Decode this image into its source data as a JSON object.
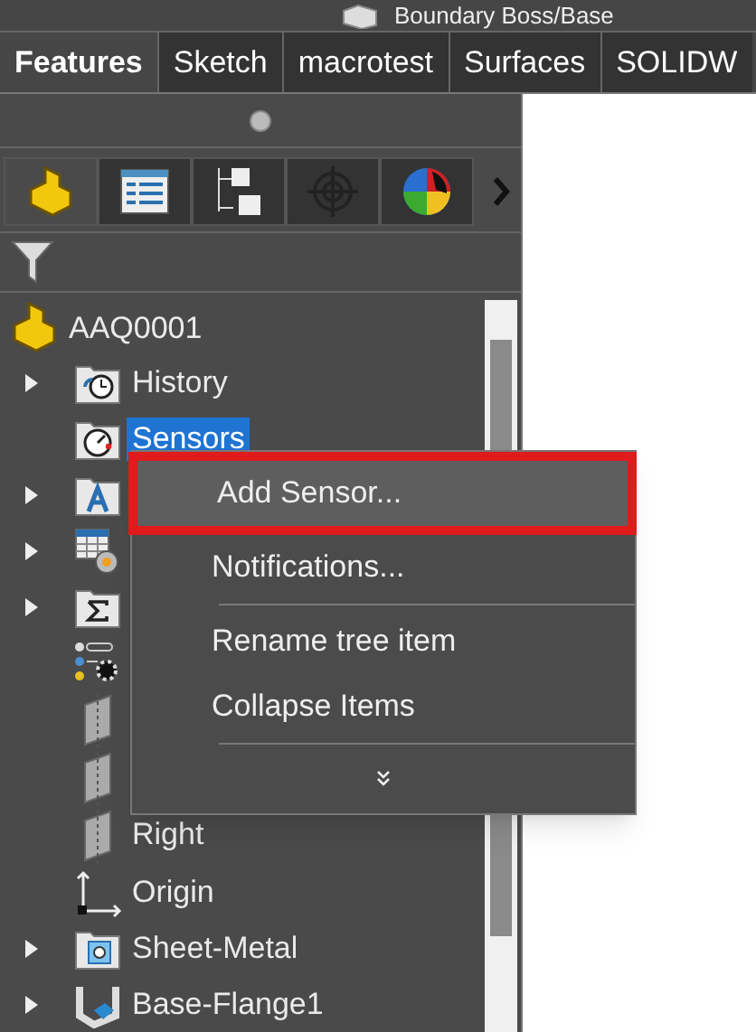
{
  "command_title": "Boundary Boss/Base",
  "tabs": [
    {
      "label": "Features",
      "selected": true
    },
    {
      "label": "Sketch",
      "selected": false
    },
    {
      "label": "macrotest",
      "selected": false
    },
    {
      "label": "Surfaces",
      "selected": false
    },
    {
      "label": "SOLIDW",
      "selected": false
    }
  ],
  "panel_tabs": [
    {
      "kind": "part",
      "selected": true
    },
    {
      "kind": "property",
      "selected": false
    },
    {
      "kind": "config",
      "selected": false
    },
    {
      "kind": "dimxpert",
      "selected": false
    },
    {
      "kind": "display",
      "selected": false
    }
  ],
  "tree": {
    "label": "AAQ0001",
    "children": [
      {
        "kind": "history",
        "label": "History",
        "expandable": true,
        "selected": false
      },
      {
        "kind": "sensors",
        "label": "Sensors",
        "selected": true
      },
      {
        "kind": "annotations",
        "expandable": true
      },
      {
        "kind": "table",
        "expandable": true
      },
      {
        "kind": "equations",
        "expandable": true
      },
      {
        "kind": "material"
      },
      {
        "kind": "plane"
      },
      {
        "kind": "plane"
      },
      {
        "kind": "plane",
        "label": "Right",
        "selected": false
      },
      {
        "kind": "origin",
        "label": "Origin",
        "selected": false
      },
      {
        "kind": "sheetmetal",
        "label": "Sheet-Metal",
        "expandable": true,
        "selected": false
      },
      {
        "kind": "flange",
        "label": "Base-Flange1",
        "expandable": true,
        "selected": false
      }
    ]
  },
  "context_menu": {
    "items": [
      {
        "kind": "item",
        "label": "Add Sensor...",
        "highlighted": true
      },
      {
        "kind": "item",
        "label": "Notifications...",
        "highlighted": false
      },
      {
        "kind": "separator"
      },
      {
        "kind": "item",
        "label": "Rename tree item",
        "highlighted": false
      },
      {
        "kind": "item",
        "label": "Collapse Items",
        "highlighted": false
      },
      {
        "kind": "separator"
      },
      {
        "kind": "more"
      }
    ]
  }
}
